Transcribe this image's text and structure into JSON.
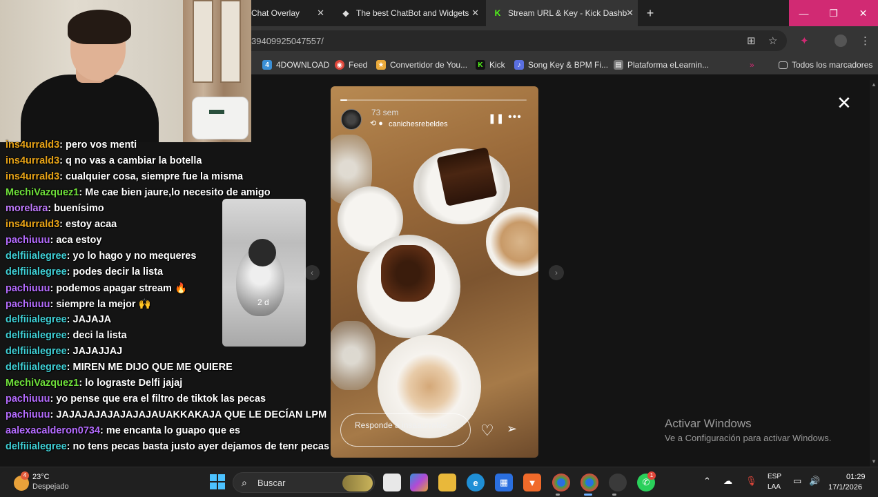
{
  "browser": {
    "tabs": [
      {
        "label": "Chat Overlay",
        "icon": "globe-icon"
      },
      {
        "label": "The best ChatBot and Widgets",
        "icon": "diamond-icon"
      },
      {
        "label": "Stream URL & Key - Kick Dashb",
        "icon": "kick-icon"
      }
    ],
    "url": "39409925047557/",
    "bookmarks": [
      {
        "label": "4DOWNLOAD",
        "color": "#3a8fd6"
      },
      {
        "label": "Feed",
        "color": "#e0463a"
      },
      {
        "label": "Convertidor de You...",
        "color": "#e9a93a"
      },
      {
        "label": "Kick",
        "color": "#53fc18"
      },
      {
        "label": "Song Key & BPM Fi...",
        "color": "#5a6fe0"
      },
      {
        "label": "Plataforma eLearnin...",
        "color": "#c9c9c9"
      }
    ],
    "all_bookmarks": "Todos los marcadores",
    "accent": "#d12a73"
  },
  "story": {
    "time": "73 sem",
    "username": "canichesrebeldes",
    "reply_placeholder": "Responde a insaaurralde_...",
    "prev_label": "2 d"
  },
  "windows_watermark": {
    "line1": "Activar Windows",
    "line2": "Ve a Configuración para activar Windows."
  },
  "chat": [
    {
      "user": "ins4urrald3",
      "color": "#e8a317",
      "text": "pero vos menti"
    },
    {
      "user": "ins4urrald3",
      "color": "#e8a317",
      "text": "q no vas a cambiar la botella"
    },
    {
      "user": "ins4urrald3",
      "color": "#e8a317",
      "text": "cualquier cosa, siempre fue la misma"
    },
    {
      "user": "MechiVazquez1",
      "color": "#6fe03a",
      "text": "Me cae bien jaure,lo necesito de amigo"
    },
    {
      "user": "morelara",
      "color": "#c17bff",
      "text": "buenísimo"
    },
    {
      "user": "ins4urrald3",
      "color": "#e8a317",
      "text": "estoy acaa"
    },
    {
      "user": "pachiuuu",
      "color": "#b56cff",
      "text": "aca estoy"
    },
    {
      "user": "delfiiialegree",
      "color": "#3fd0d6",
      "text": "yo lo hago y no mequeres"
    },
    {
      "user": "delfiiialegree",
      "color": "#3fd0d6",
      "text": "podes decir la lista"
    },
    {
      "user": "pachiuuu",
      "color": "#b56cff",
      "text": "podemos apagar stream 🔥"
    },
    {
      "user": "pachiuuu",
      "color": "#b56cff",
      "text": "siempre la mejor 🙌"
    },
    {
      "user": "delfiiialegree",
      "color": "#3fd0d6",
      "text": "JAJAJA"
    },
    {
      "user": "delfiiialegree",
      "color": "#3fd0d6",
      "text": "deci la lista"
    },
    {
      "user": "delfiiialegree",
      "color": "#3fd0d6",
      "text": "JAJAJJAJ"
    },
    {
      "user": "delfiiialegree",
      "color": "#3fd0d6",
      "text": "MIREN ME DIJO QUE ME QUIERE"
    },
    {
      "user": "MechiVazquez1",
      "color": "#6fe03a",
      "text": "lo lograste Delfi jajaj"
    },
    {
      "user": "pachiuuu",
      "color": "#b56cff",
      "text": "yo pense que era el filtro de tiktok las pecas"
    },
    {
      "user": "pachiuuu",
      "color": "#b56cff",
      "text": "JAJAJAJAJAJAJAJAUAKKAKAJA QUE LE DECÍAN LPM"
    },
    {
      "user": "aalexacalderon0734",
      "color": "#b56cff",
      "text": "me encanta lo guapo que es"
    },
    {
      "user": "delfiiialegree",
      "color": "#3fd0d6",
      "text": "no tens pecas basta justo ayer dejamos de tenr pecas"
    }
  ],
  "taskbar": {
    "temp": "23°C",
    "weather": "Despejado",
    "weather_badge": "4",
    "search": "Buscar",
    "lang1": "ESP",
    "lang2": "LAA",
    "time": "01:29",
    "date": "17/1/2026",
    "whatsapp_badge": "1"
  }
}
